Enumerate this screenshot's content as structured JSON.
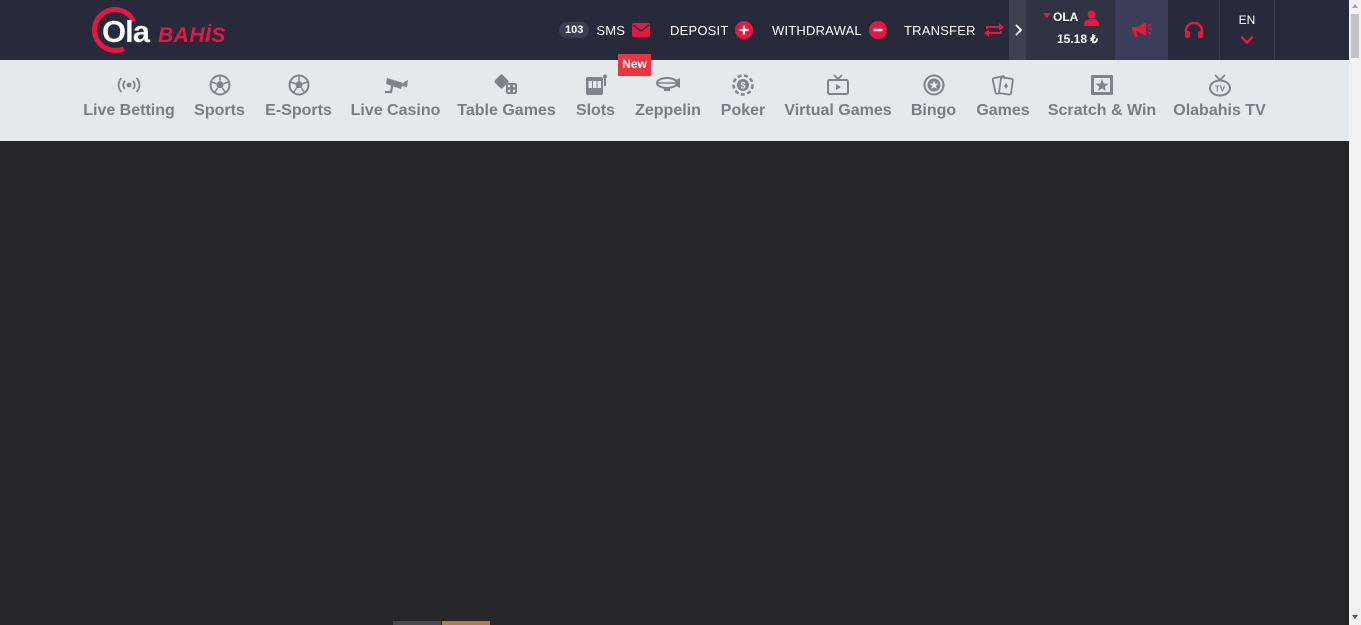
{
  "brand": {
    "logo_primary": "Ola",
    "logo_secondary": "BAHİS",
    "accent_color": "#e81740"
  },
  "header": {
    "sms": {
      "count": "103",
      "label": "SMS",
      "icon": "envelope-icon"
    },
    "deposit": {
      "label": "DEPOSIT",
      "icon": "plus-circle-icon"
    },
    "withdrawal": {
      "label": "WITHDRAWAL",
      "icon": "minus-circle-icon"
    },
    "transfer": {
      "label": "TRANSFER",
      "icon": "transfer-arrows-icon"
    },
    "user": {
      "name": "OLA",
      "balance": "15.18 ₺",
      "icon": "user-icon"
    },
    "language": {
      "code": "EN"
    }
  },
  "nav": {
    "items": [
      {
        "label": "Live Betting",
        "icon": "broadcast-icon"
      },
      {
        "label": "Sports",
        "icon": "soccer-ball-icon"
      },
      {
        "label": "E-Sports",
        "icon": "soccer-ball-icon"
      },
      {
        "label": "Live Casino",
        "icon": "camera-icon"
      },
      {
        "label": "Table Games",
        "icon": "dice-icon"
      },
      {
        "label": "Slots",
        "icon": "slot-machine-icon"
      },
      {
        "label": "Zeppelin",
        "icon": "zeppelin-icon"
      },
      {
        "label": "Poker",
        "icon": "poker-chip-icon"
      },
      {
        "label": "Virtual Games",
        "icon": "tv-screen-icon"
      },
      {
        "label": "Bingo",
        "icon": "bingo-ball-icon"
      },
      {
        "label": "Games",
        "icon": "cards-icon"
      },
      {
        "label": "Scratch & Win",
        "icon": "scratch-card-icon"
      },
      {
        "label": "Olabahis TV",
        "icon": "tv-icon"
      }
    ],
    "new_badge": "New"
  }
}
